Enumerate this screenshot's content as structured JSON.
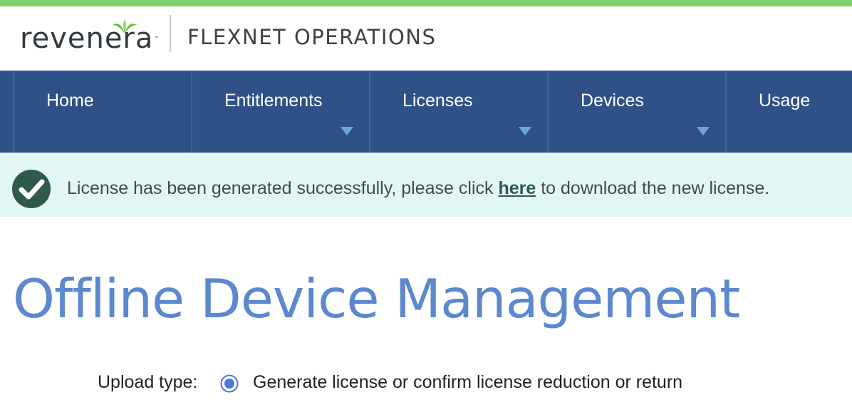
{
  "brand": {
    "logo_text_before": "reven",
    "logo_text_after": "era",
    "logo_tm": "™",
    "product_name": "FLEXNET OPERATIONS",
    "accent_color": "#7cd36b"
  },
  "nav": {
    "items": [
      {
        "label": "Home",
        "has_dropdown": false
      },
      {
        "label": "Entitlements",
        "has_dropdown": true
      },
      {
        "label": "Licenses",
        "has_dropdown": true
      },
      {
        "label": "Devices",
        "has_dropdown": true
      },
      {
        "label": "Usage",
        "has_dropdown": false
      }
    ],
    "bg_color": "#2f5187"
  },
  "alert": {
    "icon": "check-circle-icon",
    "text_before": "License has been generated successfully, please click ",
    "link_text": "here",
    "text_after": " to download the new license.",
    "bg_color": "#e2f6f3"
  },
  "page": {
    "title": "Offline Device Management"
  },
  "upload": {
    "label": "Upload type:",
    "option_label": "Generate license or confirm license reduction or return",
    "selected": true
  }
}
